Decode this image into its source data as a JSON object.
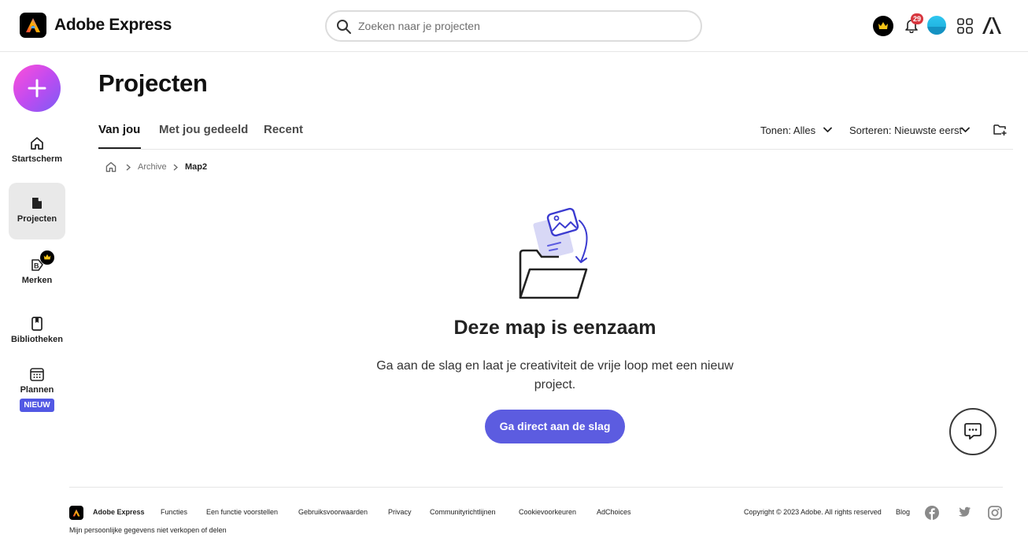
{
  "header": {
    "brand": "Adobe Express",
    "search_placeholder": "Zoeken naar je projecten",
    "notification_count": "29"
  },
  "sidebar": {
    "items": [
      {
        "label": "Startscherm"
      },
      {
        "label": "Projecten"
      },
      {
        "label": "Merken"
      },
      {
        "label": "Bibliotheken"
      },
      {
        "label": "Plannen",
        "badge": "NIEUW"
      }
    ]
  },
  "main": {
    "title": "Projecten",
    "tabs": [
      {
        "label": "Van jou"
      },
      {
        "label": "Met jou gedeeld"
      },
      {
        "label": "Recent"
      }
    ],
    "filter_label": "Tonen: Alles",
    "sort_label": "Sorteren: Nieuwste eerst",
    "breadcrumb": [
      "Archive",
      "Map2"
    ],
    "empty_title": "Deze map is eenzaam",
    "empty_desc": "Ga aan de slag en laat je creativiteit de vrije loop met een nieuw project.",
    "cta_label": "Ga direct aan de slag"
  },
  "footer": {
    "brand": "Adobe Express",
    "links": [
      "Functies",
      "Een functie voorstellen",
      "Gebruiksvoorwaarden",
      "Privacy",
      "Communityrichtlijnen",
      "Cookievoorkeuren",
      "AdChoices"
    ],
    "copyright": "Copyright © 2023 Adobe. All rights reserved",
    "blog": "Blog",
    "privacy_sell": "Mijn persoonlijke gegevens niet verkopen of delen"
  },
  "colors": {
    "accent": "#5c5ce0",
    "notification": "#d7373f",
    "new_badge": "#5258e4"
  }
}
